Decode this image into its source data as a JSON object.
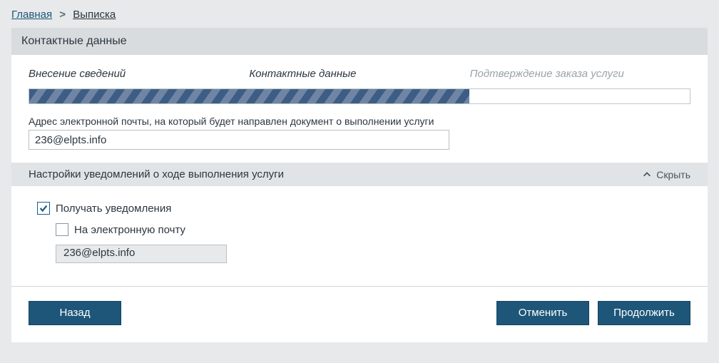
{
  "breadcrumb": {
    "home": "Главная",
    "current": "Выписка"
  },
  "card": {
    "title": "Контактные данные"
  },
  "steps": {
    "s1": "Внесение сведений",
    "s2": "Контактные данные",
    "s3": "Подтверждение заказа услуги",
    "progress_filled_pct": 66.6
  },
  "email": {
    "label": "Адрес электронной почты, на который будет направлен документ о выполнении услуги",
    "value": "236@elpts.info"
  },
  "notifications": {
    "section_title": "Настройки уведомлений о ходе выполнения услуги",
    "collapse_label": "Скрыть",
    "receive_label": "Получать уведомления",
    "receive_checked": true,
    "by_email_label": "На электронную почту",
    "by_email_checked": false,
    "email_value": "236@elpts.info"
  },
  "buttons": {
    "back": "Назад",
    "cancel": "Отменить",
    "continue": "Продолжить"
  }
}
